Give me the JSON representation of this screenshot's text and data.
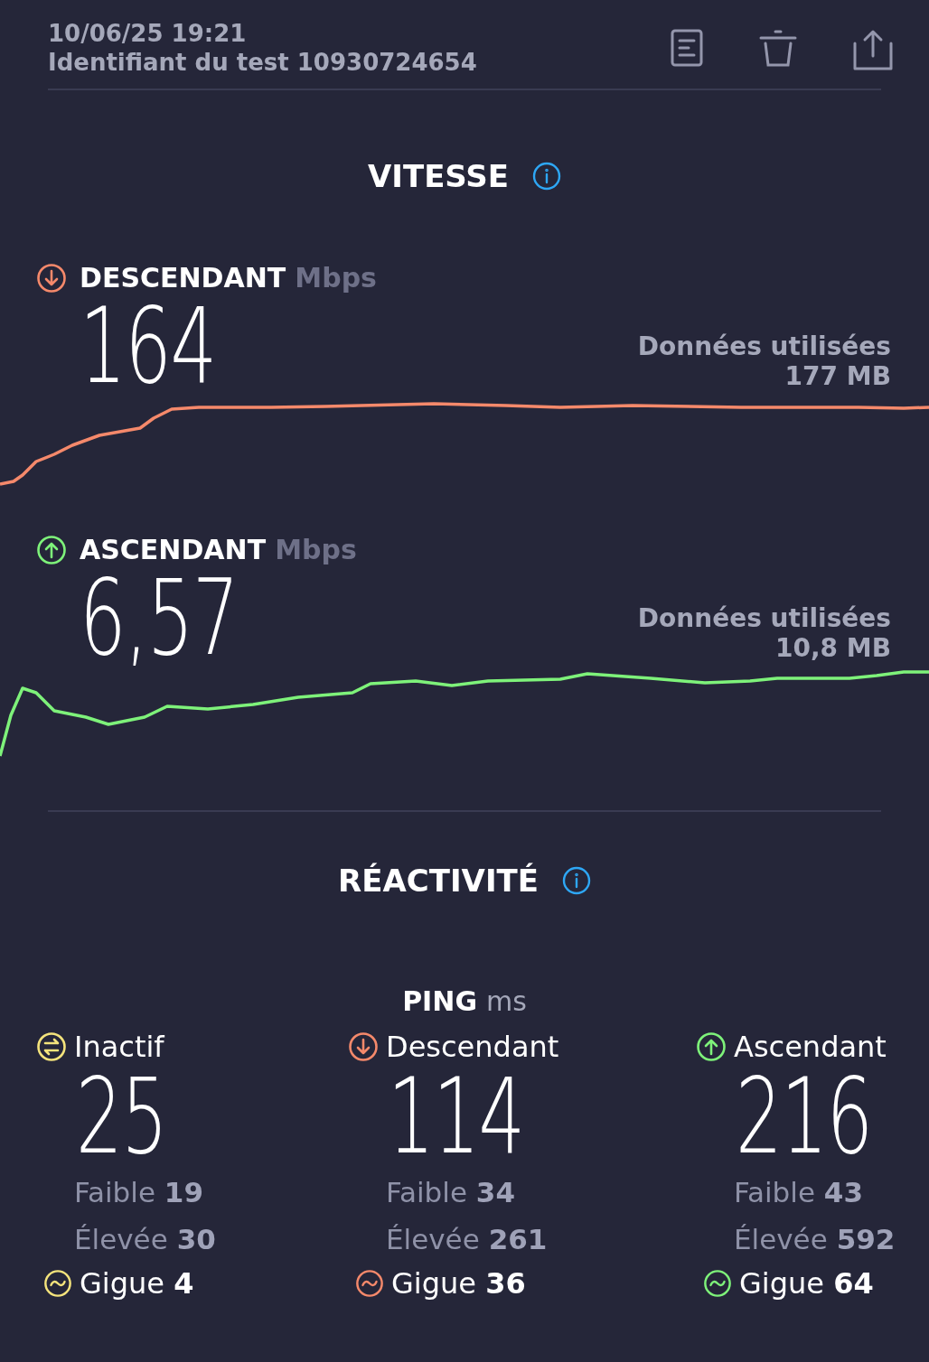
{
  "header": {
    "timestamp": "10/06/25 19:21",
    "test_id": "Identifiant du test 10930724654"
  },
  "speed": {
    "title": "VITESSE",
    "sections": [
      {
        "kind": "download",
        "color": "#f5896b",
        "label": "DESCENDANT",
        "unit": "Mbps",
        "value": "164",
        "data_label": "Données utilisées",
        "data_value": "177 MB"
      },
      {
        "kind": "upload",
        "color": "#7ef27a",
        "label": "ASCENDANT",
        "unit": "Mbps",
        "value": "6,57",
        "data_label": "Données utilisées",
        "data_value": "10,8 MB"
      }
    ]
  },
  "responsiveness": {
    "title": "RÉACTIVITÉ",
    "ping": {
      "label": "PING",
      "unit": "ms",
      "columns": [
        {
          "kind": "idle",
          "color": "#f4e37c",
          "label": "Inactif",
          "value": "25",
          "low": "Faible **19**",
          "high": "Élevée **30**",
          "jitter": "Gigue **4**"
        },
        {
          "kind": "download",
          "color": "#f5896b",
          "label": "Descendant",
          "value": "114",
          "low": "Faible **34**",
          "high": "Élevée **261**",
          "jitter": "Gigue **36**"
        },
        {
          "kind": "upload",
          "color": "#7ef27a",
          "label": "Ascendant",
          "value": "216",
          "low": "Faible **43**",
          "high": "Élevée **592**",
          "jitter": "Gigue **64**"
        }
      ]
    }
  }
}
